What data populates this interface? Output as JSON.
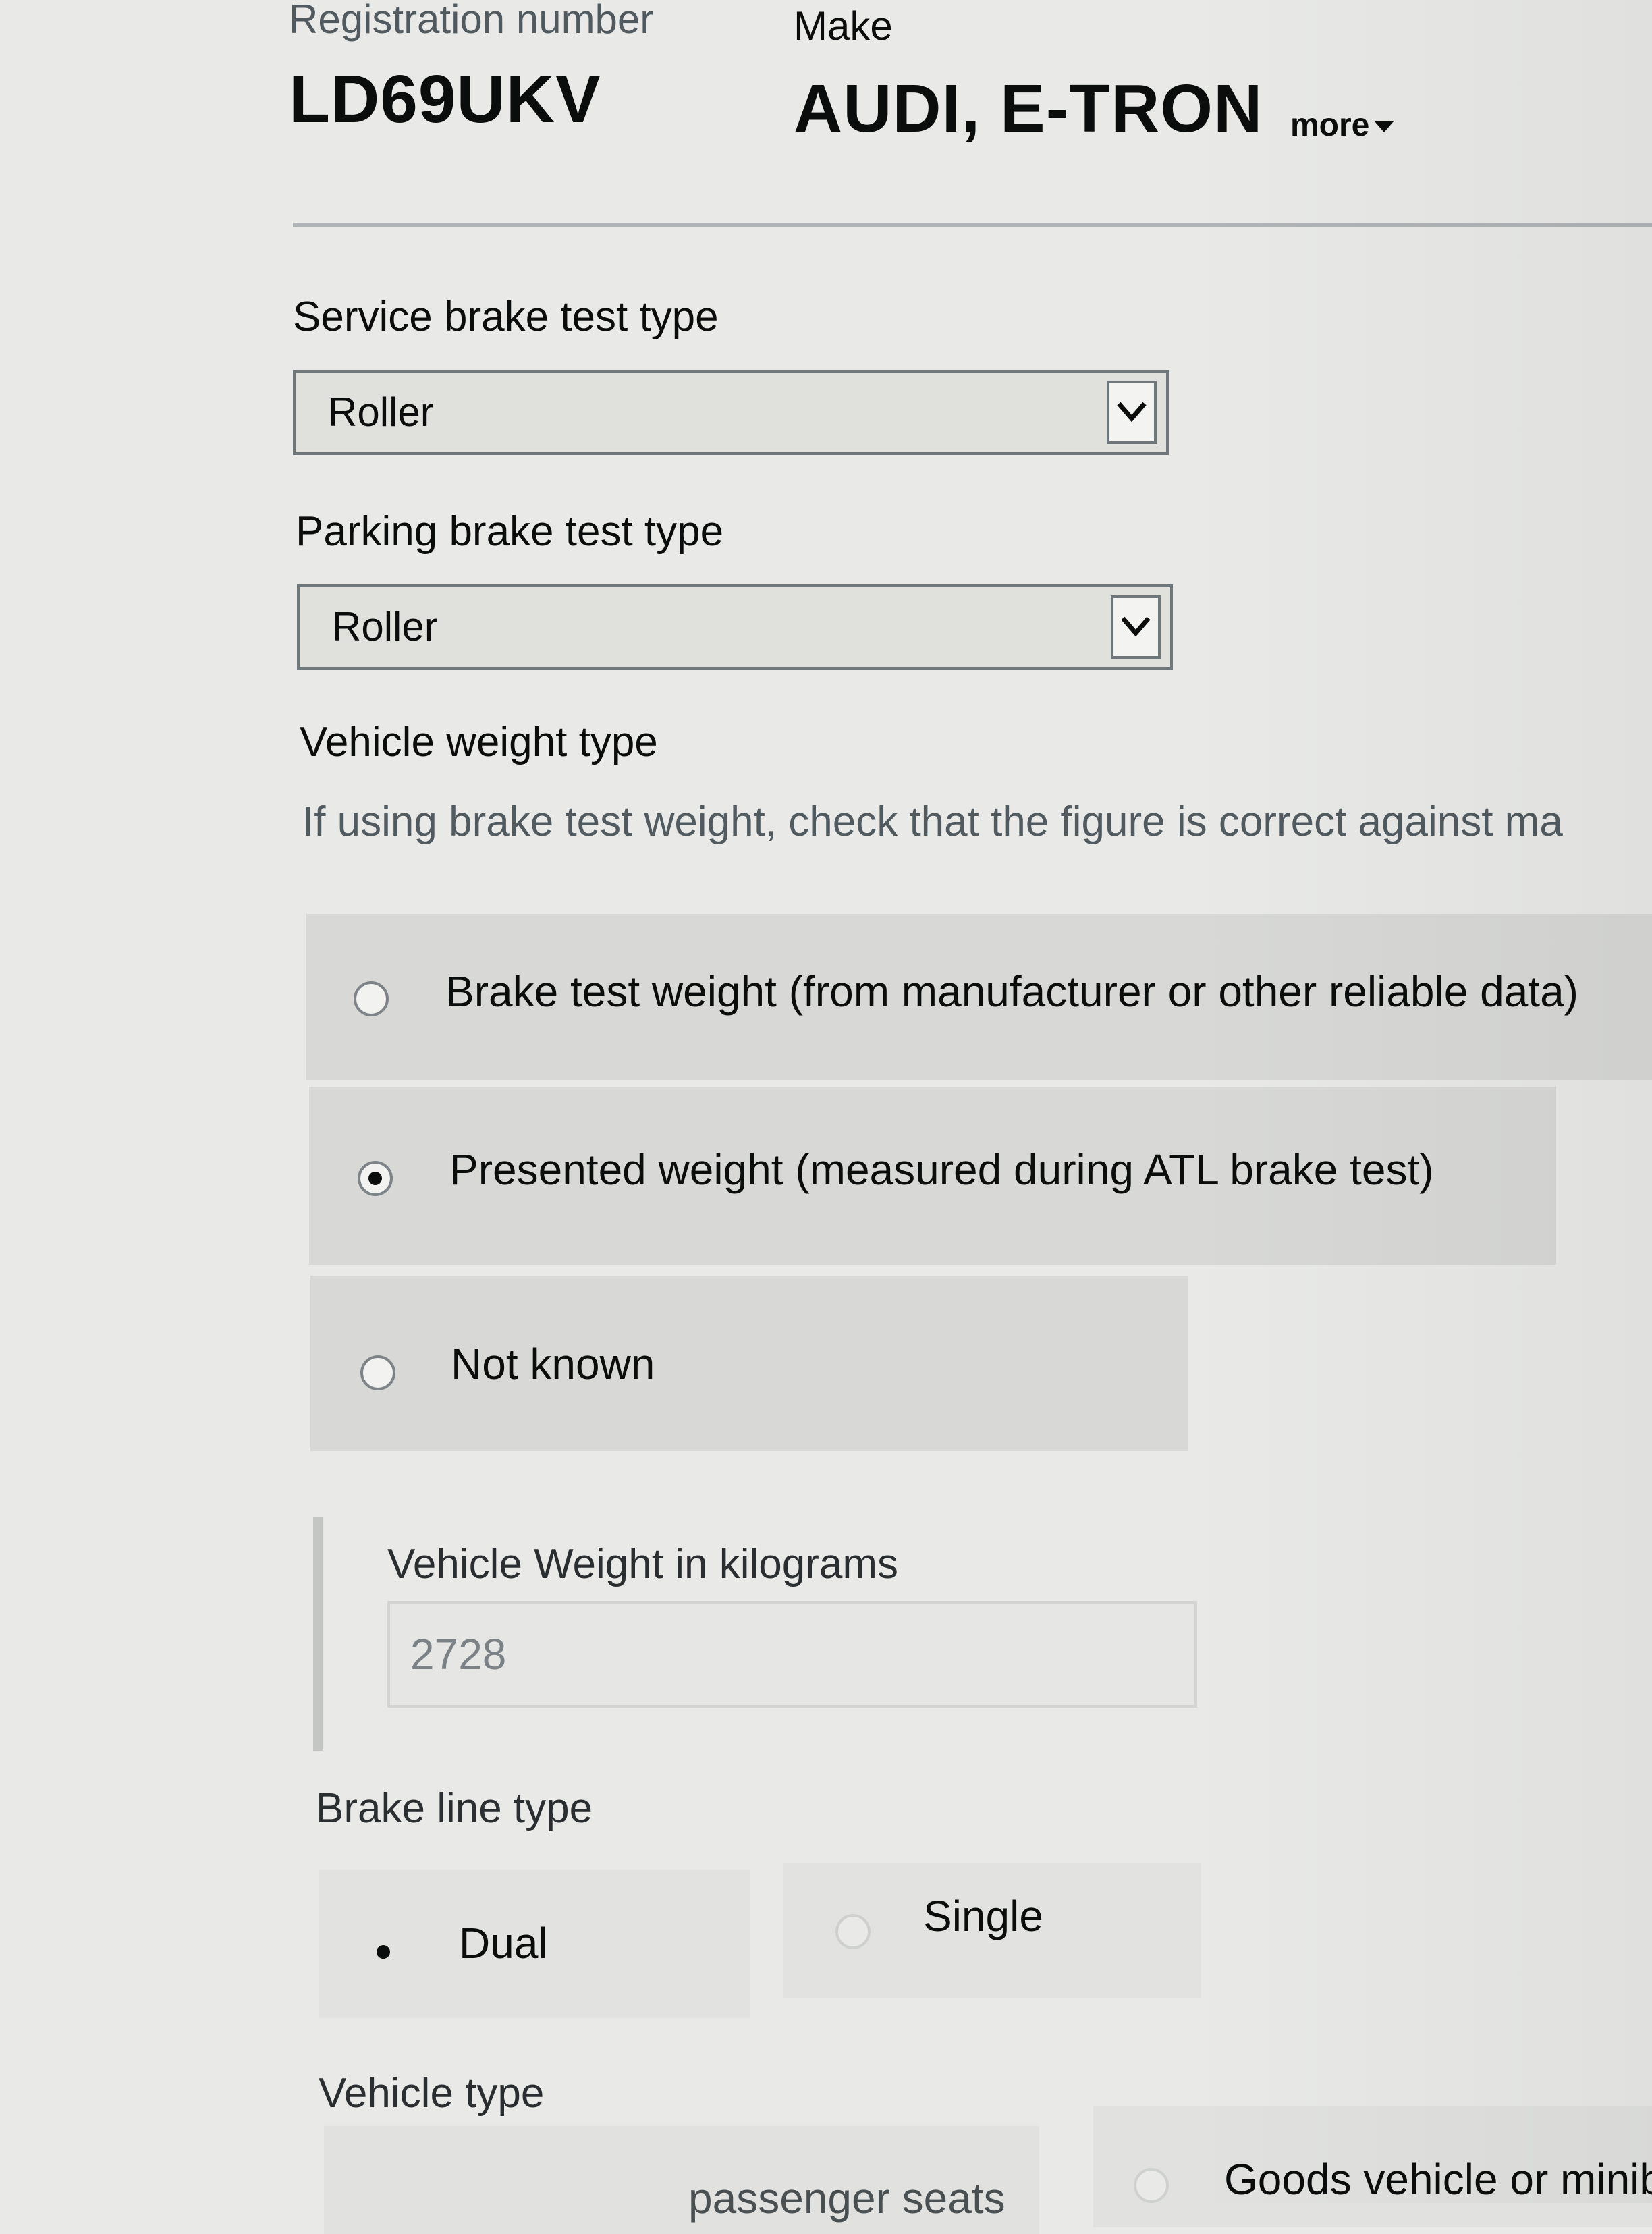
{
  "vehicle": {
    "registration_label": "Registration number",
    "registration_value": "LD69UKV",
    "make_label": "Make",
    "make_value": "AUDI, E-TRON",
    "more_label": "more"
  },
  "service_brake": {
    "label": "Service brake test type",
    "selected": "Roller"
  },
  "parking_brake": {
    "label": "Parking brake test type",
    "selected": "Roller"
  },
  "weight_type": {
    "label": "Vehicle weight type",
    "hint": "If using brake test weight, check that the figure is correct against ma",
    "options": [
      {
        "label": "Brake test weight (from manufacturer or other reliable data)",
        "checked": false
      },
      {
        "label": "Presented weight (measured during ATL brake test)",
        "checked": true
      },
      {
        "label": "Not known",
        "checked": false
      }
    ]
  },
  "vehicle_weight": {
    "label": "Vehicle Weight in kilograms",
    "value": "2728"
  },
  "brake_line": {
    "label": "Brake line type",
    "options": [
      {
        "label": "Dual",
        "checked": true
      },
      {
        "label": "Single",
        "checked": false
      }
    ]
  },
  "vehicle_type": {
    "label": "Vehicle type",
    "options": [
      {
        "label": "passenger seats",
        "checked": false
      },
      {
        "label": "Goods vehicle or minib",
        "checked": false
      }
    ]
  }
}
